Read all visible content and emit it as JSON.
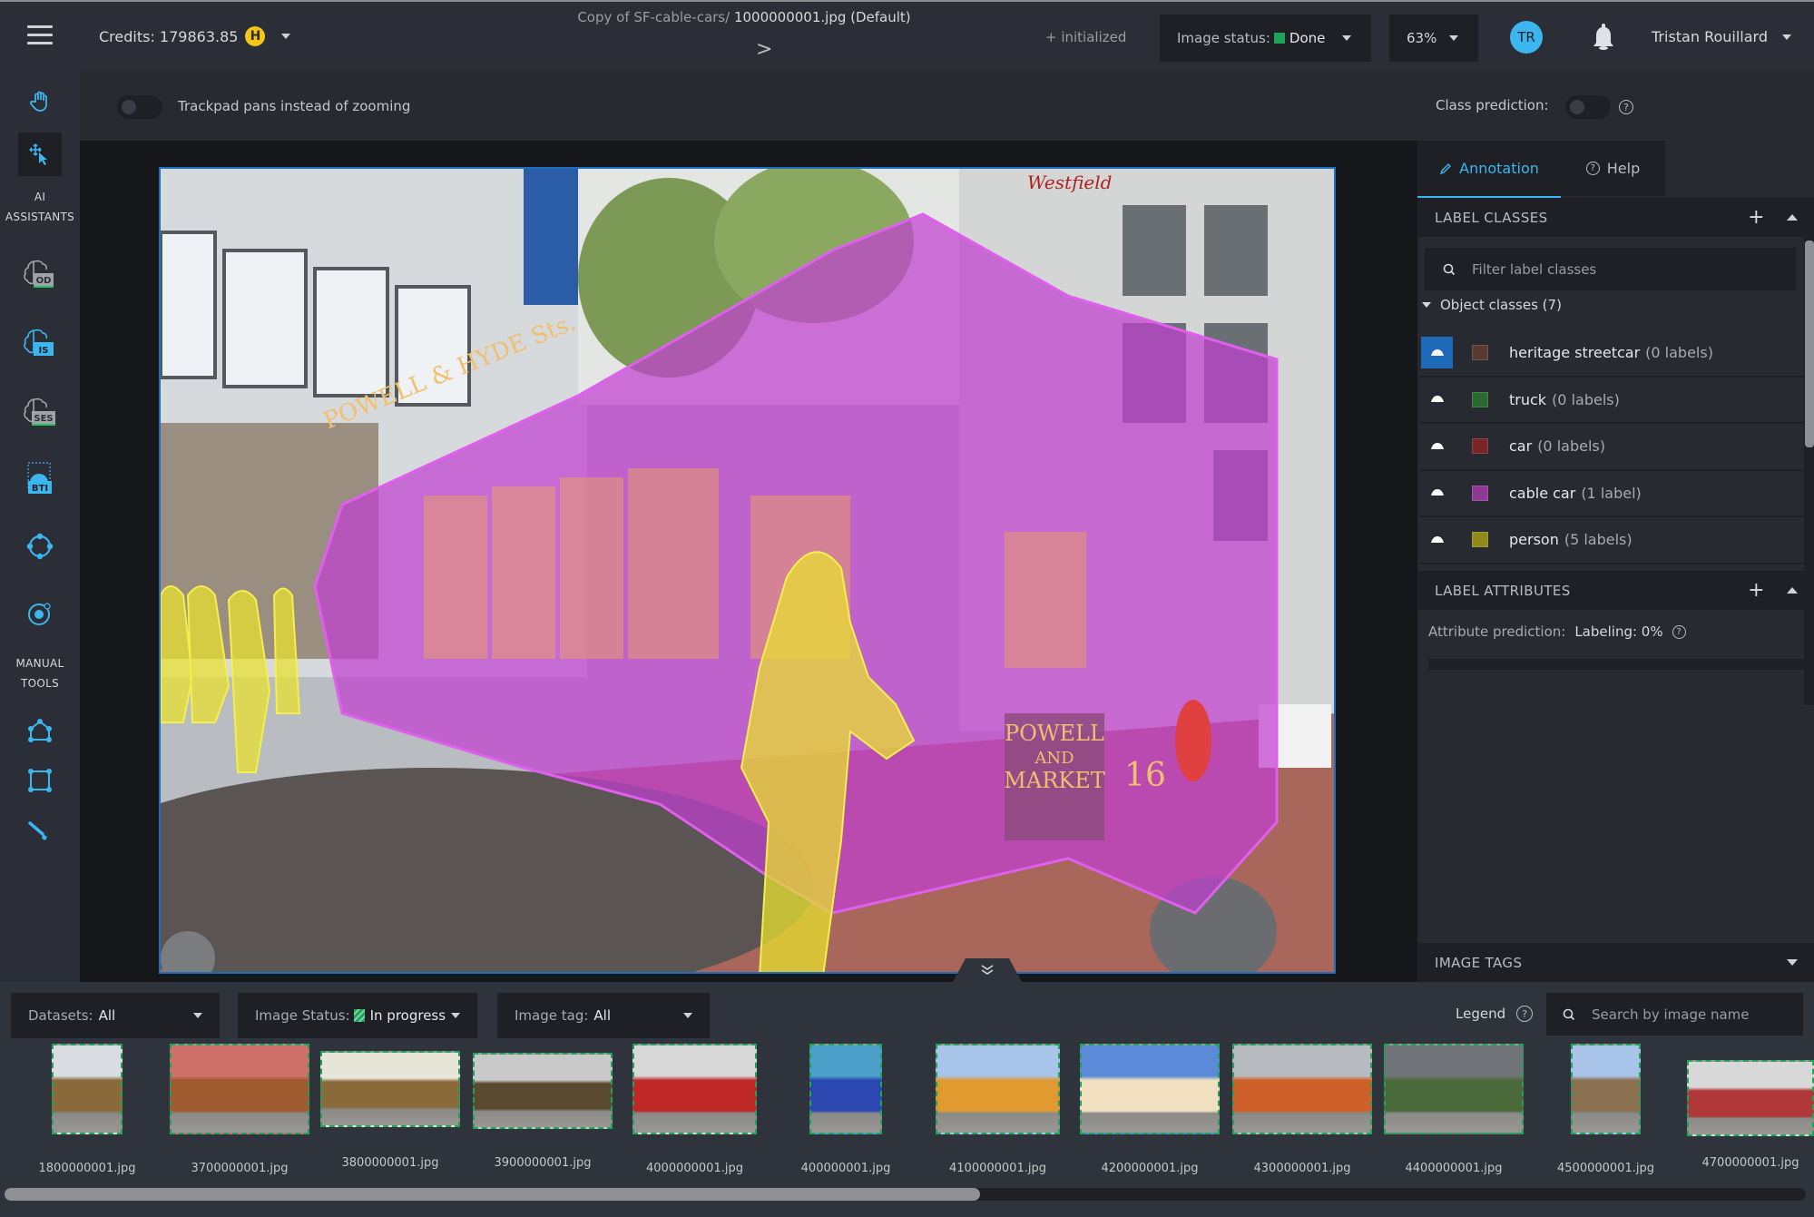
{
  "topbar": {
    "credits_label": "Credits: 179863.85",
    "credits_coin": "H",
    "path_prefix": "Copy of SF-cable-cars/ ",
    "filename": "1000000001.jpg (Default)",
    "next_arrow": ">",
    "init_status": "+ initialized",
    "image_status_label": "Image status:",
    "image_status_value": "Done",
    "image_status_color": "#1fa35a",
    "zoom_value": "63%",
    "avatar_initials": "TR",
    "user_name": "Tristan Rouillard"
  },
  "left_toolbar": {
    "sections": {
      "ai_assistants_line1": "AI",
      "ai_assistants_line2": "ASSISTANTS",
      "manual_tools_line1": "MANUAL",
      "manual_tools_line2": "TOOLS"
    },
    "ai_badges": {
      "od": "OD",
      "is": "IS",
      "ses": "SES",
      "bti": "BTI"
    },
    "tools": [
      {
        "name": "hand-pan",
        "active": false
      },
      {
        "name": "select-move",
        "active": true
      },
      {
        "name": "object-detection",
        "active": false
      },
      {
        "name": "instance-segmentation",
        "active": false
      },
      {
        "name": "semantic-segmentation",
        "active": false
      },
      {
        "name": "bounding-box-to-instance",
        "active": false
      },
      {
        "name": "extreme-points",
        "active": false
      },
      {
        "name": "click-segmentation",
        "active": false
      },
      {
        "name": "polygon",
        "active": false
      },
      {
        "name": "rectangle",
        "active": false
      },
      {
        "name": "brush",
        "active": false
      }
    ]
  },
  "subbar": {
    "trackpad_label": "Trackpad pans instead of zooming",
    "trackpad_on": false,
    "class_prediction_label": "Class prediction:",
    "class_prediction_on": false,
    "help": "?"
  },
  "right_panel": {
    "tabs": [
      {
        "label": "Annotation",
        "active": true
      },
      {
        "label": "Help",
        "active": false
      }
    ],
    "label_classes_title": "LABEL CLASSES",
    "filter_placeholder": "Filter label classes",
    "object_classes_label": "Object classes (7)",
    "classes": [
      {
        "name": "heritage streetcar",
        "count": "(0 labels)",
        "color": "#5a3a30",
        "visible_highlight": true
      },
      {
        "name": "truck",
        "count": "(0 labels)",
        "color": "#2a6a2e",
        "visible_highlight": false
      },
      {
        "name": "car",
        "count": "(0 labels)",
        "color": "#7a2428",
        "visible_highlight": false
      },
      {
        "name": "cable car",
        "count": "(1 label)",
        "color": "#8e3a92",
        "visible_highlight": false
      },
      {
        "name": "person",
        "count": "(5 labels)",
        "color": "#8f8a1a",
        "visible_highlight": false
      }
    ],
    "label_attributes_title": "LABEL ATTRIBUTES",
    "attribute_prediction_label": "Attribute prediction:",
    "attribute_prediction_value": "Labeling: 0%",
    "attribute_prediction_progress": 0,
    "image_tags_title": "IMAGE TAGS"
  },
  "bottom": {
    "datasets_label": "Datasets:",
    "datasets_value": "All",
    "image_status_label": "Image Status:",
    "image_status_value": "In progress",
    "image_tag_label": "Image tag:",
    "image_tag_value": "All",
    "legend_label": "Legend",
    "search_placeholder": "Search by image name",
    "scroll_position_fraction": 0.0,
    "thumbnails": [
      {
        "label": "1800000001.jpg"
      },
      {
        "label": "3700000001.jpg"
      },
      {
        "label": "3800000001.jpg"
      },
      {
        "label": "3900000001.jpg"
      },
      {
        "label": "4000000001.jpg"
      },
      {
        "label": "400000001.jpg"
      },
      {
        "label": "4100000001.jpg"
      },
      {
        "label": "4200000001.jpg"
      },
      {
        "label": "4300000001.jpg"
      },
      {
        "label": "4400000001.jpg"
      },
      {
        "label": "4500000001.jpg"
      },
      {
        "label": "4700000001.jpg"
      }
    ]
  },
  "canvas": {
    "image_text_signs": {
      "roof_sign": "POWELL & HYDE Sts.",
      "front_sign_1": "POWELL",
      "front_sign_2": "AND",
      "front_sign_3": "MARKET",
      "car_number": "16",
      "store_sign": "Westfield"
    },
    "mask_colors": {
      "cable_car": "#c040d0",
      "person": "#e8e030"
    }
  }
}
